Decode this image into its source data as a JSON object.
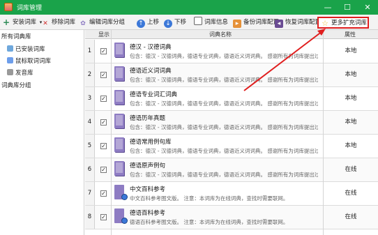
{
  "window": {
    "title": "词库管理",
    "min": "—",
    "max": "☐",
    "close": "✕"
  },
  "toolbar": {
    "items": [
      {
        "label": "安装词库",
        "icon": "plus-icon",
        "caret": "▾"
      },
      {
        "label": "移除词库",
        "icon": "x-icon"
      },
      {
        "label": "编辑词库分组",
        "icon": "gear-icon"
      },
      {
        "label": "上移",
        "icon": "up-arrow-icon"
      },
      {
        "label": "下移",
        "icon": "down-arrow-icon"
      },
      {
        "label": "词库信息",
        "icon": "info-icon"
      },
      {
        "label": "备份词库配置",
        "icon": "backup-icon"
      },
      {
        "label": "恢复词库配置",
        "icon": "restore-icon"
      },
      {
        "label": "更多扩充词库",
        "icon": "star-icon"
      }
    ]
  },
  "sidebar": {
    "all_label": "所有词典库",
    "items": [
      {
        "label": "已安装词库",
        "icon": "installed-icon"
      },
      {
        "label": "鼠标取词词库",
        "icon": "mouse-icon"
      },
      {
        "label": "发音库",
        "icon": "speaker-icon"
      }
    ],
    "groups_label": "词典库分组"
  },
  "grid": {
    "headers": {
      "show": "显示",
      "name": "词典名称",
      "attr": "属性"
    },
    "rows": [
      {
        "idx": "1",
        "name": "德汉 - 汉德词典",
        "desc": "包含：德汉 - 汉德词典，德语专业词典，德语近义词词典。    感谢所有为词库提出过修",
        "attr": "本地",
        "checked": "✓",
        "icon": "book-icon"
      },
      {
        "idx": "2",
        "name": "德语近义词词典",
        "desc": "包含：德汉 - 汉德词典，德语专业词典，德语近义词词典。    感谢所有为词库提出过修",
        "attr": "本地",
        "checked": "✓",
        "icon": "book-icon"
      },
      {
        "idx": "3",
        "name": "德语专业词汇词典",
        "desc": "包含：德汉 - 汉德词典，德语专业词典，德语近义词词典。    感谢所有为词库提出过修",
        "attr": "本地",
        "checked": "✓",
        "icon": "book-icon"
      },
      {
        "idx": "4",
        "name": "德语历年真题",
        "desc": "包含：德汉 - 汉德词典，德语专业词典，德语近义词词典。    感谢所有为词库提出过修",
        "attr": "本地",
        "checked": "✓",
        "icon": "book-icon"
      },
      {
        "idx": "5",
        "name": "德语常用例句库",
        "desc": "包含：德汉 - 汉德词典，德语专业词典，德语近义词词典。    感谢所有为词库提出过修",
        "attr": "本地",
        "checked": "✓",
        "icon": "book-icon"
      },
      {
        "idx": "6",
        "name": "德语原声例句",
        "desc": "包含：德汉 - 汉德词典，德语专业词典，德语近义词词典。    感谢所有为词库提出过修",
        "attr": "在线",
        "checked": "✓",
        "icon": "book-icon"
      },
      {
        "idx": "7",
        "name": "中文百科参考",
        "desc": "中文百科参考图文版。    注意：本词库为在线词典，查找时需要联网。",
        "attr": "在线",
        "checked": "✓",
        "icon": "globe-book-icon"
      },
      {
        "idx": "8",
        "name": "德语百科参考",
        "desc": "德语百科参考图文版。    注意：本词库为在线词典，查找时需要联网。",
        "attr": "在线",
        "checked": "✓",
        "icon": "globe-book-icon"
      }
    ]
  },
  "colors": {
    "titlebar": "#1aa34a",
    "highlight": "#e01e1e"
  }
}
